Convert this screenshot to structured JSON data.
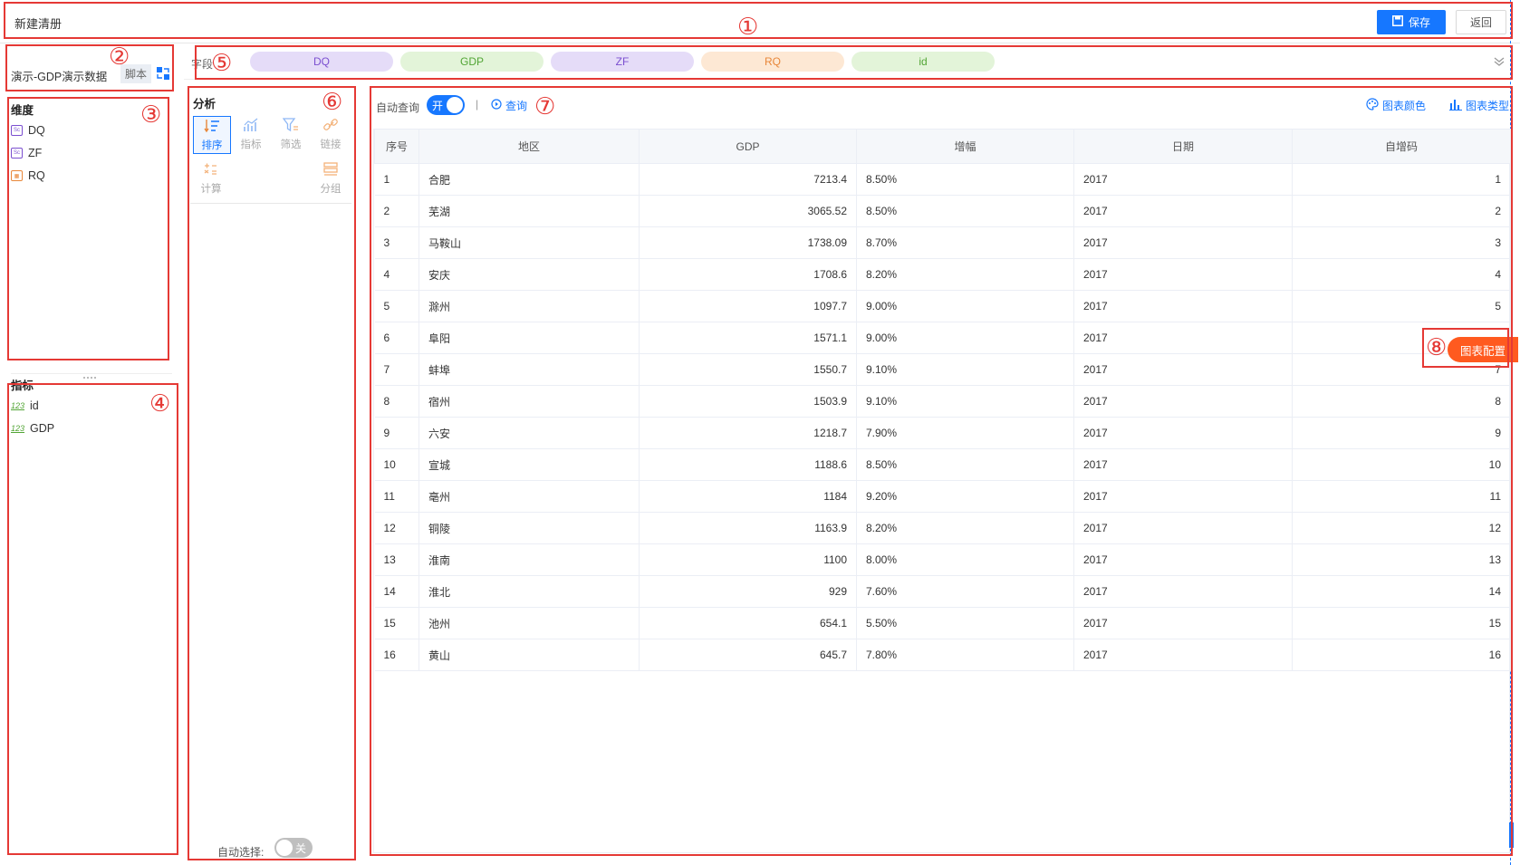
{
  "header": {
    "title": "新建清册",
    "save_label": "保存",
    "back_label": "返回"
  },
  "dataset": {
    "name": "演示-GDP演示数据",
    "script_label": "脚本"
  },
  "dimensions": {
    "title": "维度",
    "items": [
      {
        "name": "DQ",
        "type": "string"
      },
      {
        "name": "ZF",
        "type": "string"
      },
      {
        "name": "RQ",
        "type": "date"
      }
    ]
  },
  "metrics": {
    "title": "指标",
    "type_label": "123",
    "items": [
      {
        "name": "id"
      },
      {
        "name": "GDP"
      }
    ]
  },
  "fields_bar": {
    "label": "字段",
    "chips": [
      {
        "name": "DQ",
        "bg": "#e5dcf8",
        "fg": "#7b4fd0"
      },
      {
        "name": "GDP",
        "bg": "#e3f4d9",
        "fg": "#52a535"
      },
      {
        "name": "ZF",
        "bg": "#e5dcf8",
        "fg": "#7b4fd0"
      },
      {
        "name": "RQ",
        "bg": "#fde8d4",
        "fg": "#e8873a"
      },
      {
        "name": "id",
        "bg": "#e3f4d9",
        "fg": "#52a535"
      }
    ]
  },
  "analysis": {
    "title": "分析",
    "tools": [
      {
        "label": "排序",
        "icon": "sort-icon",
        "active": true
      },
      {
        "label": "指标",
        "icon": "metric-chart-icon",
        "active": false
      },
      {
        "label": "筛选",
        "icon": "filter-icon",
        "active": false
      },
      {
        "label": "链接",
        "icon": "link-icon",
        "active": false
      },
      {
        "label": "计算",
        "icon": "calculator-icon",
        "active": false
      },
      {
        "label": "分组",
        "icon": "group-icon",
        "active": false
      }
    ],
    "auto_select_label": "自动选择:",
    "auto_select_state": "关"
  },
  "query": {
    "auto_query_label": "自动查询",
    "auto_query_state": "开",
    "separator": "|",
    "query_label": "查询",
    "chart_color_label": "图表颜色",
    "chart_type_label": "图表类型"
  },
  "table": {
    "headers": [
      "序号",
      "地区",
      "GDP",
      "增幅",
      "日期",
      "自增码"
    ],
    "rows": [
      [
        "1",
        "合肥",
        "7213.4",
        "8.50%",
        "2017",
        "1"
      ],
      [
        "2",
        "芜湖",
        "3065.52",
        "8.50%",
        "2017",
        "2"
      ],
      [
        "3",
        "马鞍山",
        "1738.09",
        "8.70%",
        "2017",
        "3"
      ],
      [
        "4",
        "安庆",
        "1708.6",
        "8.20%",
        "2017",
        "4"
      ],
      [
        "5",
        "滁州",
        "1097.7",
        "9.00%",
        "2017",
        "5"
      ],
      [
        "6",
        "阜阳",
        "1571.1",
        "9.00%",
        "2017",
        ""
      ],
      [
        "7",
        "蚌埠",
        "1550.7",
        "9.10%",
        "2017",
        "7"
      ],
      [
        "8",
        "宿州",
        "1503.9",
        "9.10%",
        "2017",
        "8"
      ],
      [
        "9",
        "六安",
        "1218.7",
        "7.90%",
        "2017",
        "9"
      ],
      [
        "10",
        "宣城",
        "1188.6",
        "8.50%",
        "2017",
        "10"
      ],
      [
        "11",
        "亳州",
        "1184",
        "9.20%",
        "2017",
        "11"
      ],
      [
        "12",
        "铜陵",
        "1163.9",
        "8.20%",
        "2017",
        "12"
      ],
      [
        "13",
        "淮南",
        "1100",
        "8.00%",
        "2017",
        "13"
      ],
      [
        "14",
        "淮北",
        "929",
        "7.60%",
        "2017",
        "14"
      ],
      [
        "15",
        "池州",
        "654.1",
        "5.50%",
        "2017",
        "15"
      ],
      [
        "16",
        "黄山",
        "645.7",
        "7.80%",
        "2017",
        "16"
      ]
    ]
  },
  "chart_config_label": "图表配置",
  "annotations": [
    "①",
    "②",
    "③",
    "④",
    "⑤",
    "⑥",
    "⑦",
    "⑧"
  ]
}
